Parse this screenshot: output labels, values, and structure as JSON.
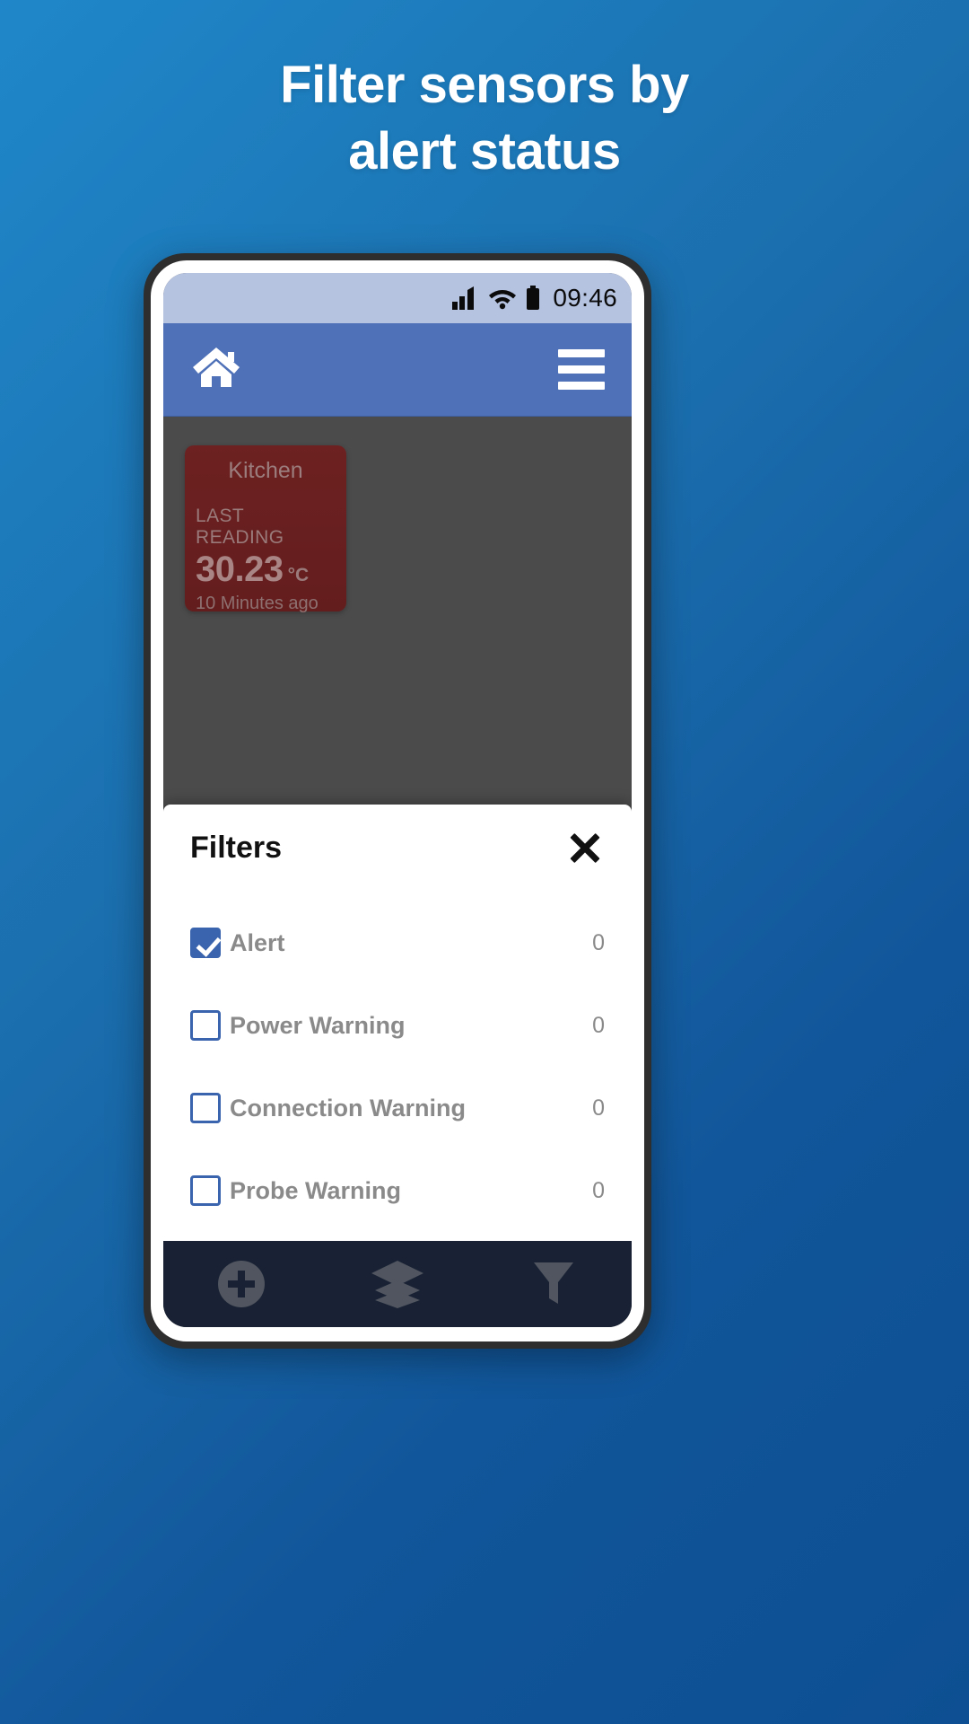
{
  "promo": {
    "line1": "Filter sensors by",
    "line2": "alert status"
  },
  "status_bar": {
    "time": "09:46",
    "signal_icon": "cellular-signal-icon",
    "wifi_icon": "wifi-icon",
    "battery_icon": "battery-icon",
    "background_color": "#b5c2e0"
  },
  "app_bar": {
    "home_icon": "home-icon",
    "menu_icon": "hamburger-menu-icon",
    "background_color": "#4e71b8"
  },
  "sensor_card": {
    "title": "Kitchen",
    "label": "LAST READING",
    "value": "30.23",
    "unit": "°C",
    "timestamp": "10 Minutes ago",
    "state_color": "#6d2121"
  },
  "filters": {
    "title": "Filters",
    "close_icon": "close-icon",
    "accent_color": "#3a64ad",
    "rows": [
      {
        "label": "Alert",
        "count": "0",
        "checked": true
      },
      {
        "label": "Power Warning",
        "count": "0",
        "checked": false
      },
      {
        "label": "Connection Warning",
        "count": "0",
        "checked": false
      },
      {
        "label": "Probe Warning",
        "count": "0",
        "checked": false
      }
    ]
  },
  "bottom_nav": {
    "background_color": "#182234",
    "items": [
      {
        "icon": "add-circle-icon"
      },
      {
        "icon": "layers-icon"
      },
      {
        "icon": "filter-funnel-icon"
      }
    ]
  }
}
